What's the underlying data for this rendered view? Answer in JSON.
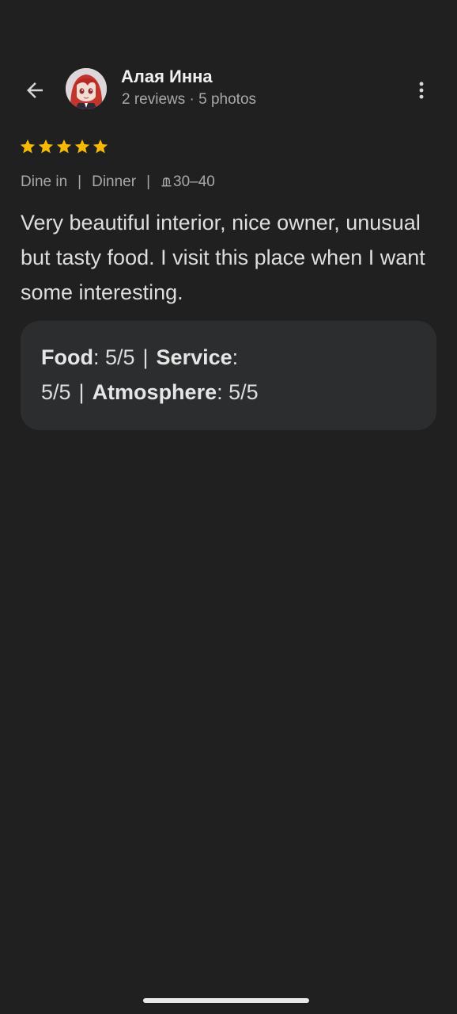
{
  "header": {
    "user_name": "Алая Инна",
    "user_meta": "2 reviews · 5 photos"
  },
  "review": {
    "rating": 5,
    "rating_max": 5,
    "star_color": "#f6b907",
    "tags": {
      "service_type": "Dine in",
      "meal_type": "Dinner",
      "price_range": "30–40"
    },
    "text": "Very beautiful interior, nice owner, unusual but tasty food. I visit this place when I want some interesting."
  },
  "ratings": {
    "food_label": "Food",
    "food_value": ": 5/5",
    "service_label": "Service",
    "service_value": "5/5",
    "atmosphere_label": "Atmosphere",
    "atmosphere_value": ": 5/5"
  },
  "icons": {
    "back": "arrow-back-icon",
    "menu": "more-vertical-icon",
    "price": "price-icon"
  },
  "colors": {
    "background": "#202020",
    "card": "#2c2d2f"
  }
}
